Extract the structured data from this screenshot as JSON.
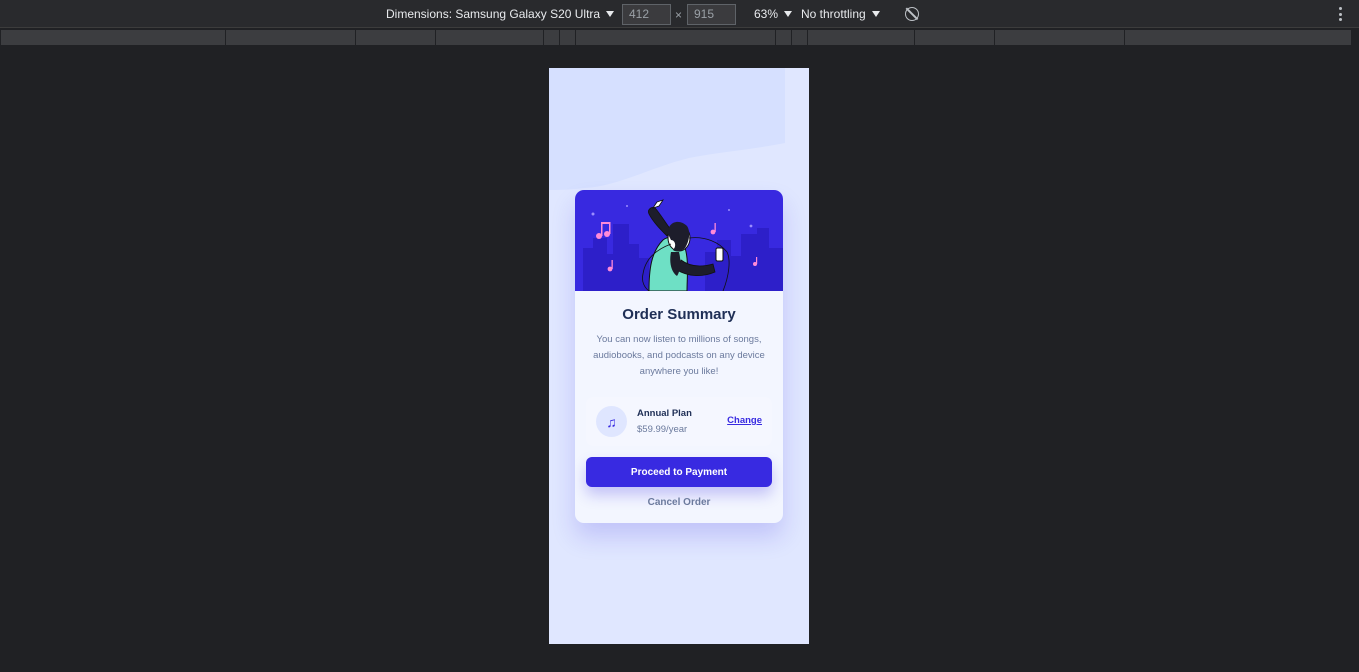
{
  "devtools": {
    "dimensions_label": "Dimensions: Samsung Galaxy S20 Ultra",
    "width": "412",
    "height": "915",
    "times": "×",
    "zoom": "63%",
    "throttling": "No throttling",
    "icons": [
      "rotate-icon",
      "kebab-icon"
    ]
  },
  "card": {
    "title": "Order Summary",
    "description": "You can now listen to millions of songs, audiobooks, and podcasts on any device anywhere you like!",
    "plan": {
      "icon": "music-note-icon",
      "name": "Annual Plan",
      "price": "$59.99/year",
      "change_label": "Change"
    },
    "pay_label": "Proceed to Payment",
    "cancel_label": "Cancel Order"
  },
  "colors": {
    "primary": "#382ae1",
    "page_bg": "#e0e7ff",
    "card_bg": "#f3f6ff",
    "devtools_bg": "#292a2d"
  }
}
